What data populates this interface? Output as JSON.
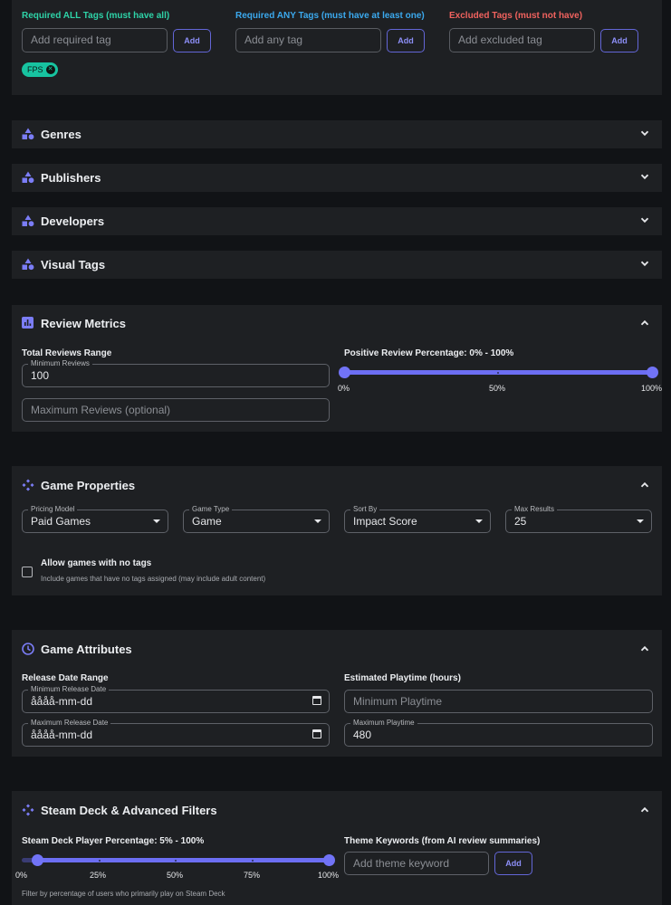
{
  "tags": {
    "required_all": {
      "label": "Required ALL Tags (must have all)",
      "placeholder": "Add required tag",
      "button": "Add",
      "color": "#2ed3a8"
    },
    "required_any": {
      "label": "Required ANY Tags (must have at least one)",
      "placeholder": "Add any tag",
      "button": "Add",
      "color": "#3ba9ee"
    },
    "excluded": {
      "label": "Excluded Tags (must not have)",
      "placeholder": "Add excluded tag",
      "button": "Add",
      "color": "#f0625e"
    },
    "chips": [
      {
        "label": "FPS"
      }
    ]
  },
  "accordions": {
    "genres": "Genres",
    "publishers": "Publishers",
    "developers": "Developers",
    "visual_tags": "Visual Tags"
  },
  "review_metrics": {
    "title": "Review Metrics",
    "total_label": "Total Reviews Range",
    "min_label": "Minimum Reviews",
    "min_value": "100",
    "max_placeholder": "Maximum Reviews (optional)",
    "positive_label": "Positive Review Percentage: 0% - 100%",
    "slider_min": 0,
    "slider_max": 100,
    "marks": [
      "0%",
      "50%",
      "100%"
    ]
  },
  "game_properties": {
    "title": "Game Properties",
    "pricing": {
      "label": "Pricing Model",
      "value": "Paid Games"
    },
    "type": {
      "label": "Game Type",
      "value": "Game"
    },
    "sort": {
      "label": "Sort By",
      "value": "Impact Score"
    },
    "max_results": {
      "label": "Max Results",
      "value": "25"
    },
    "no_tags_label": "Allow games with no tags",
    "no_tags_help": "Include games that have no tags assigned (may include adult content)"
  },
  "game_attributes": {
    "title": "Game Attributes",
    "release_label": "Release Date Range",
    "min_date_label": "Minimum Release Date",
    "min_date_value": "åååå-mm-dd",
    "max_date_label": "Maximum Release Date",
    "max_date_value": "åååå-mm-dd",
    "playtime_label": "Estimated Playtime (hours)",
    "min_playtime_placeholder": "Minimum Playtime",
    "max_playtime_label": "Maximum Playtime",
    "max_playtime_value": "480"
  },
  "steam_deck": {
    "title": "Steam Deck & Advanced Filters",
    "player_label": "Steam Deck Player Percentage: 5% - 100%",
    "slider_min": 5,
    "slider_max": 100,
    "marks": [
      "0%",
      "25%",
      "50%",
      "75%",
      "100%"
    ],
    "help": "Filter by percentage of users who primarily play on Steam Deck",
    "theme_label": "Theme Keywords (from AI review summaries)",
    "theme_placeholder": "Add theme keyword",
    "theme_button": "Add"
  },
  "colors": {
    "accent": "#6c6ef3",
    "panel": "#1e2023",
    "background": "#111316"
  },
  "icons": {
    "section": "category-icon",
    "review": "bar-chart-icon",
    "properties": "gamepad-icon",
    "attributes": "clock-icon",
    "chevron": "chevron-icon"
  }
}
